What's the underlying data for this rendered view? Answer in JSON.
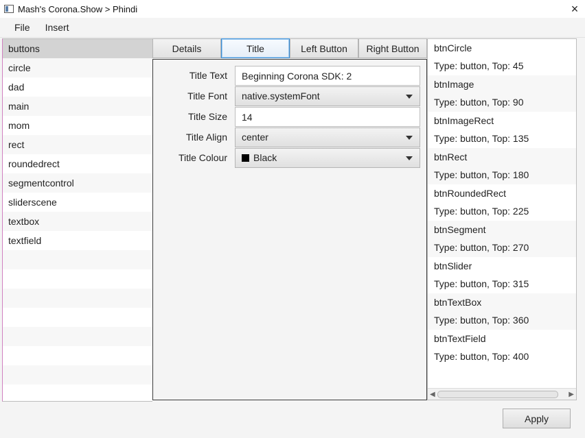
{
  "window": {
    "title": "Mash's Corona.Show > Phindi",
    "icon": "app-window-icon",
    "close_icon": "×"
  },
  "menu": [
    "File",
    "Insert"
  ],
  "scenes": {
    "items": [
      "buttons",
      "circle",
      "dad",
      "main",
      "mom",
      "rect",
      "roundedrect",
      "segmentcontrol",
      "sliderscene",
      "textbox",
      "textfield"
    ],
    "selected": "buttons"
  },
  "tabs": {
    "items": [
      "Details",
      "Title",
      "Left Button",
      "Right Button"
    ],
    "active": "Title"
  },
  "form": {
    "title_text": {
      "label": "Title Text",
      "value": "Beginning Corona SDK: 2"
    },
    "title_font": {
      "label": "Title Font",
      "value": "native.systemFont"
    },
    "title_size": {
      "label": "Title Size",
      "value": "14"
    },
    "title_align": {
      "label": "Title Align",
      "value": "center"
    },
    "title_colour": {
      "label": "Title Colour",
      "value": "Black",
      "swatch_color": "#000000"
    }
  },
  "objects": [
    {
      "name": "btnCircle",
      "info": "Type: button, Top: 45"
    },
    {
      "name": "btnImage",
      "info": "Type: button, Top: 90"
    },
    {
      "name": "btnImageRect",
      "info": "Type: button, Top: 135"
    },
    {
      "name": "btnRect",
      "info": "Type: button, Top: 180"
    },
    {
      "name": "btnRoundedRect",
      "info": "Type: button, Top: 225"
    },
    {
      "name": "btnSegment",
      "info": "Type: button, Top: 270"
    },
    {
      "name": "btnSlider",
      "info": "Type: button, Top: 315"
    },
    {
      "name": "btnTextBox",
      "info": "Type: button, Top: 360"
    },
    {
      "name": "btnTextField",
      "info": "Type: button, Top: 400"
    }
  ],
  "apply_label": "Apply",
  "colors": {
    "accent": "#3c8fd6",
    "selected_row": "#d3d3d3"
  }
}
